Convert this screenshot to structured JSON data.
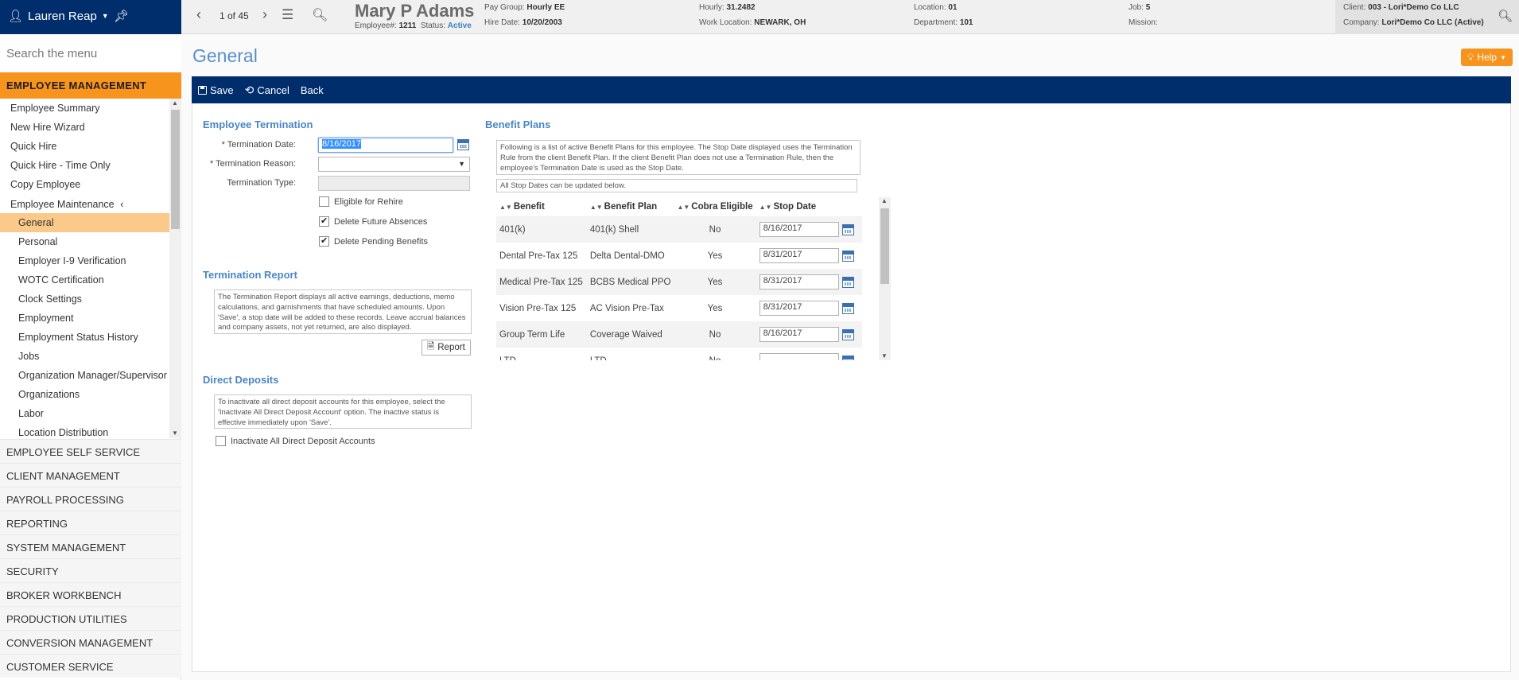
{
  "topbar": {
    "user_name": "Lauren Reap",
    "pager": "1 of 45",
    "employee": {
      "name": "Mary P Adams",
      "number_label": "Employee#:",
      "number": "1211",
      "status_label": "Status:",
      "status": "Active",
      "pay_group_label": "Pay Group:",
      "pay_group": "Hourly EE",
      "hire_date_label": "Hire Date:",
      "hire_date": "10/20/2003",
      "hourly_label": "Hourly:",
      "hourly": "31.2482",
      "work_location_label": "Work Location:",
      "work_location": "NEWARK, OH",
      "location_label": "Location:",
      "location": "01",
      "department_label": "Department:",
      "department": "101",
      "job_label": "Job:",
      "job": "5",
      "mission_label": "Mission:",
      "mission": ""
    },
    "client_label": "Client:",
    "client": "003 - Lori*Demo Co LLC",
    "company_label": "Company:",
    "company": "Lori*Demo Co LLC (Active)"
  },
  "sidebar": {
    "search_placeholder": "Search the menu",
    "active_section": "EMPLOYEE MANAGEMENT",
    "items": [
      {
        "label": "Employee Summary",
        "level": 1
      },
      {
        "label": "New Hire Wizard",
        "level": 1
      },
      {
        "label": "Quick Hire",
        "level": 1
      },
      {
        "label": "Quick Hire - Time Only",
        "level": 1
      },
      {
        "label": "Copy Employee",
        "level": 1
      },
      {
        "label": "Employee Maintenance",
        "level": 1,
        "expanded": true
      },
      {
        "label": "General",
        "level": 2,
        "selected": true
      },
      {
        "label": "Personal",
        "level": 2
      },
      {
        "label": "Employer I-9 Verification",
        "level": 2
      },
      {
        "label": "WOTC Certification",
        "level": 2
      },
      {
        "label": "Clock Settings",
        "level": 2
      },
      {
        "label": "Employment",
        "level": 2
      },
      {
        "label": "Employment Status History",
        "level": 2
      },
      {
        "label": "Jobs",
        "level": 2
      },
      {
        "label": "Organization Manager/Supervisor",
        "level": 2
      },
      {
        "label": "Organizations",
        "level": 2
      },
      {
        "label": "Labor",
        "level": 2
      },
      {
        "label": "Location Distribution",
        "level": 2
      }
    ],
    "sections": [
      "EMPLOYEE SELF SERVICE",
      "CLIENT MANAGEMENT",
      "PAYROLL PROCESSING",
      "REPORTING",
      "SYSTEM MANAGEMENT",
      "SECURITY",
      "BROKER WORKBENCH",
      "PRODUCTION UTILITIES",
      "CONVERSION MANAGEMENT",
      "CUSTOMER SERVICE"
    ]
  },
  "main": {
    "title": "General",
    "help_label": "Help",
    "toolbar": {
      "save": "Save",
      "cancel": "Cancel",
      "back": "Back"
    },
    "termination": {
      "title": "Employee Termination",
      "date_label": "Termination Date:",
      "date_value": "8/16/2017",
      "reason_label": "Termination Reason:",
      "reason_value": "",
      "type_label": "Termination Type:",
      "eligible_rehire": "Eligible for Rehire",
      "delete_absences": "Delete Future Absences",
      "delete_benefits": "Delete Pending Benefits"
    },
    "report": {
      "title": "Termination Report",
      "text": "The Termination Report displays all active earnings, deductions, memo calculations, and garnishments that have scheduled amounts. Upon 'Save', a stop date will be added to these records. Leave accrual balances and company assets, not yet returned, are also displayed.",
      "button": "Report"
    },
    "deposits": {
      "title": "Direct Deposits",
      "text": "To inactivate all direct deposit accounts for this employee, select the 'Inactivate All Direct Deposit Account' option. The inactive status is effective immediately upon 'Save'.",
      "checkbox": "Inactivate All Direct Deposit Accounts"
    },
    "benefits": {
      "title": "Benefit Plans",
      "text": "Following is a list of active Benefit Plans for this employee. The Stop Date displayed uses the Termination Rule from the client Benefit Plan. If the client Benefit Plan does not use a Termination Rule, then the employee's Termination Date is used as the Stop Date.",
      "note": "All Stop Dates can be updated below.",
      "columns": [
        "Benefit",
        "Benefit Plan",
        "Cobra Eligible",
        "Stop Date"
      ],
      "rows": [
        {
          "benefit": "401(k)",
          "plan": "401(k) Shell",
          "cobra": "No",
          "stop": "8/16/2017"
        },
        {
          "benefit": "Dental Pre-Tax 125",
          "plan": "Delta Dental-DMO",
          "cobra": "Yes",
          "stop": "8/31/2017"
        },
        {
          "benefit": "Medical Pre-Tax 125",
          "plan": "BCBS Medical PPO",
          "cobra": "Yes",
          "stop": "8/31/2017"
        },
        {
          "benefit": "Vision Pre-Tax 125",
          "plan": "AC Vision Pre-Tax",
          "cobra": "Yes",
          "stop": "8/31/2017"
        },
        {
          "benefit": "Group Term Life",
          "plan": "Coverage Waived",
          "cobra": "No",
          "stop": "8/16/2017"
        },
        {
          "benefit": "LTD",
          "plan": "LTD",
          "cobra": "No",
          "stop": ""
        }
      ]
    }
  },
  "colors": {
    "navy": "#002e6d",
    "orange": "#f7941d",
    "selected_item": "#fbc98a",
    "title_blue": "#5b8fc7"
  }
}
